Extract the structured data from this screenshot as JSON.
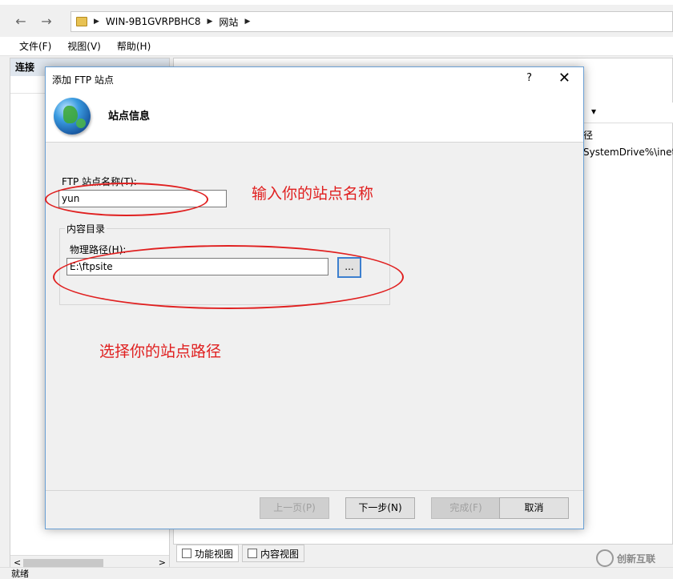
{
  "iis": {
    "breadcrumb": [
      "WIN-9B1GVRPBHC8",
      "网站"
    ],
    "menu": [
      "文件(F)",
      "视图(V)",
      "帮助(H)"
    ],
    "left_pane_title": "连接",
    "right_col_head": "径",
    "right_text_1": "径",
    "right_text_2": "SystemDrive%\\inetp",
    "bottom_tabs": [
      "功能视图",
      "内容视图"
    ],
    "status": "就绪",
    "watermark": "创新互联"
  },
  "dialog": {
    "title": "添加 FTP 站点",
    "help": "?",
    "close": "✕",
    "header_title": "站点信息",
    "site_name_label": "FTP 站点名称(T):",
    "site_name_value": "yun",
    "content_group_label": "内容目录",
    "physical_path_label": "物理路径(H):",
    "physical_path_value": "E:\\ftpsite",
    "browse_label": "...",
    "buttons": {
      "prev": "上一页(P)",
      "next": "下一步(N)",
      "finish": "完成(F)",
      "cancel": "取消"
    }
  },
  "annotations": {
    "name_hint": "输入你的站点名称",
    "path_hint": "选择你的站点路径"
  },
  "colors": {
    "annotation_red": "#e02020",
    "accent_blue": "#3c7fcf"
  }
}
